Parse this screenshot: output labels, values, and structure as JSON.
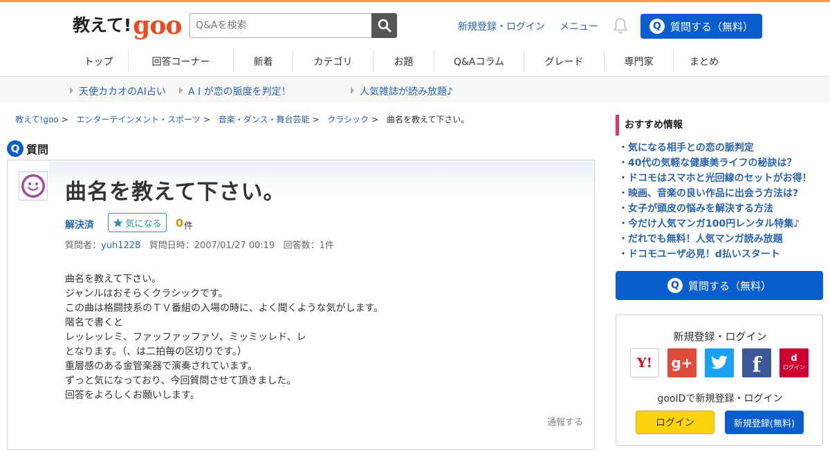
{
  "header": {
    "logo_text": "教えて!",
    "logo_brand": "goo",
    "search_placeholder": "Q&Aを検索",
    "register_login": "新規登録・ログイン",
    "menu": "メニュー",
    "ask_button": "質問する（無料）"
  },
  "nav": {
    "items": [
      "トップ",
      "回答コーナー",
      "新着",
      "カテゴリ",
      "お題",
      "Q&Aコラム",
      "グレード",
      "専門家",
      "まとめ"
    ]
  },
  "promo": {
    "items": [
      "天使カカオのAI占い",
      "A I が恋の脈度を判定！",
      "人気雑誌が読み放題♪"
    ]
  },
  "breadcrumb": {
    "items": [
      "教えて!goo",
      "エンターテインメント・スポーツ",
      "音楽・ダンス・舞台芸能",
      "クラシック"
    ],
    "separator": ">",
    "current": "曲名を教えて下さい。"
  },
  "question": {
    "section_label": "質問",
    "q_glyph": "Q",
    "title": "曲名を教えて下さい。",
    "status": "解決済",
    "fav_label": "気になる",
    "fav_count": "0",
    "fav_unit": "件",
    "meta_asker_label": "質問者：",
    "asker": "yuh1228",
    "meta_date_label": "質問日時：",
    "date": "2007/01/27 00:19",
    "meta_answers_label": "回答数：",
    "answers": "1件",
    "body_lines": [
      "曲名を教えて下さい。",
      "ジャンルはおそらくクラシックです。",
      "この曲は格闘技系のＴＶ番組の入場の時に、よく聞くような気がします。",
      "階名で書くと",
      "レッレッレミ、ファッファッファソ、ミッミッレド、レ",
      "となります。（、は二拍毎の区切りです。）",
      "重層感のある金管楽器で演奏されています。",
      "ずっと気になっており、今回質問させて頂きました。",
      "回答をよろしくお願いします。"
    ],
    "report": "通報する"
  },
  "sidebar": {
    "recommend_title": "おすすめ情報",
    "recommend_items": [
      "気になる相手との恋の脈判定",
      "40代の気軽な健康美ライフの秘訣は？",
      "ドコモはスマホと光回線のセットがお得！",
      "映画、音楽の良い作品に出会う方法は?",
      "女子が頭皮の悩みを解決する方法",
      "今だけ人気マンガ100円レンタル特集♪",
      "だれでも無料！人気マンガ読み放題",
      "ドコモユーザ必見！d払いスタート"
    ],
    "ask_button": "質問する（無料）",
    "login_title": "新規登録・ログイン",
    "sns": {
      "yahoo": "Y!",
      "google": "g+",
      "twitter": "twitter-icon",
      "facebook": "f",
      "docomo": "d",
      "docomo_sub": "ログイン"
    },
    "goo_id_text": "gooIDで新規登録・ログイン",
    "login_button": "ログイン",
    "register_button": "新規登録(無料)"
  },
  "colors": {
    "accent": "#f39a53",
    "brand_blue": "#0a5dcc",
    "link": "#2a64b0",
    "pink": "#e8336a",
    "yellow": "#fbd20c"
  }
}
